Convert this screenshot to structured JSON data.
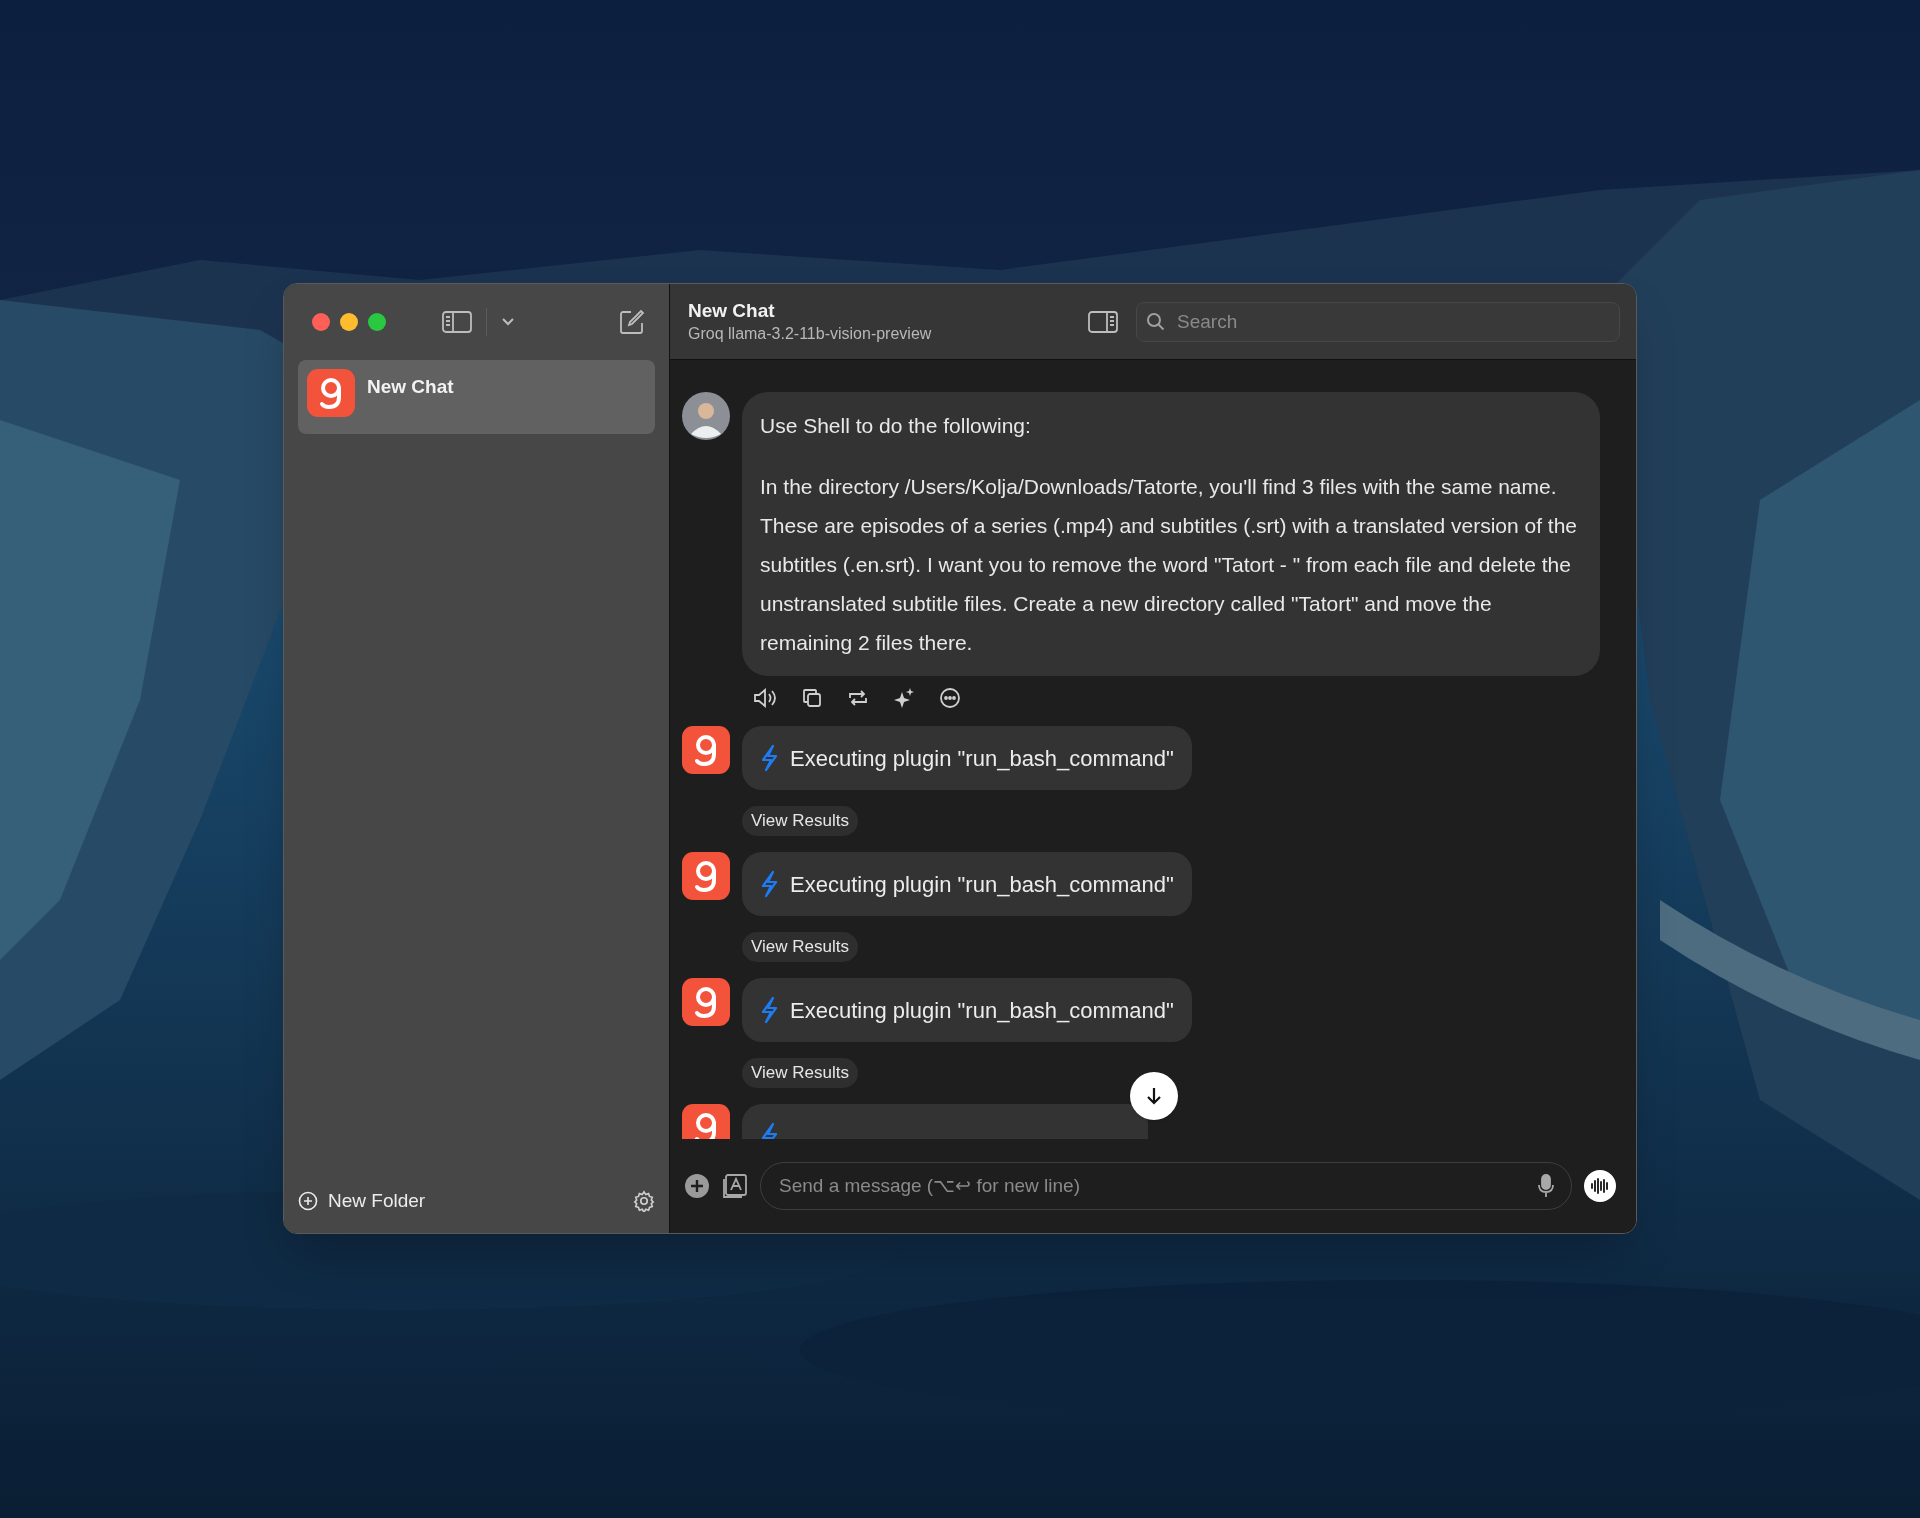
{
  "window": {
    "title": "New Chat",
    "subtitle": "Groq llama-3.2-11b-vision-preview"
  },
  "sidebar": {
    "chats": [
      {
        "title": "New Chat",
        "selected": true
      }
    ],
    "new_folder": "New Folder"
  },
  "search": {
    "placeholder": "Search"
  },
  "messages": [
    {
      "kind": "user",
      "paragraphs": [
        "Use Shell to do the following:",
        "In the directory /Users/Kolja/Downloads/Tatorte, you'll find 3 files with the same name. These are episodes of a series (.mp4) and subtitles (.srt) with a translated version of the subtitles (.en.srt). I want you to remove the word \"Tatort - \" from each file and delete the unstranslated subtitle files. Create a new directory called \"Tatort\" and move the remaining 2 files there."
      ]
    },
    {
      "kind": "plugin",
      "text": "Executing plugin \"run_bash_command\"",
      "button": "View Results"
    },
    {
      "kind": "plugin",
      "text": "Executing plugin \"run_bash_command\"",
      "button": "View Results"
    },
    {
      "kind": "plugin",
      "text": "Executing plugin \"run_bash_command\"",
      "button": "View Results"
    },
    {
      "kind": "plugin"
    }
  ],
  "composer": {
    "placeholder": "Send a message (⌥↩ for new line)"
  }
}
